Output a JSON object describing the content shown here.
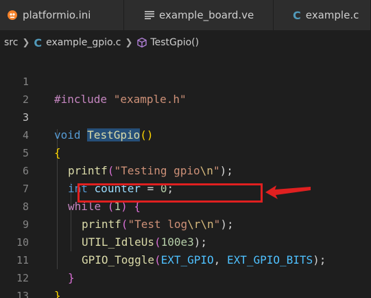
{
  "tabs": [
    {
      "label": "platformio.ini",
      "icon": "platformio-icon"
    },
    {
      "label": "example_board.ve",
      "icon": "lines-icon"
    },
    {
      "label": "example.c",
      "icon": "c-file-icon"
    }
  ],
  "breadcrumb": {
    "folder": "src",
    "file": "example_gpio.c",
    "symbol": "TestGpio()"
  },
  "editor": {
    "line_numbers": [
      "1",
      "2",
      "3",
      "4",
      "5",
      "6",
      "7",
      "8",
      "9",
      "10",
      "11",
      "12",
      "13"
    ],
    "active_line": "3",
    "code": {
      "l1_directive": "#include",
      "l1_header": "\"example.h\"",
      "l3_type": "void",
      "l3_func": "TestGpio",
      "l3_parens": "()",
      "l4_brace": "{",
      "l5_func": "printf",
      "l5_open": "(",
      "l5_str": "\"Testing gpio",
      "l5_esc": "\\n",
      "l5_str_end": "\"",
      "l5_close": ");",
      "l6_type": "int",
      "l6_var": "counter",
      "l6_eq": " = ",
      "l6_num": "0",
      "l6_semi": ";",
      "l7_kw": "while",
      "l7_open": " (",
      "l7_num": "1",
      "l7_close": ") ",
      "l7_brace": "{",
      "l8_func": "printf",
      "l8_open": "(",
      "l8_str": "\"Test log",
      "l8_esc": "\\r\\n",
      "l8_str_end": "\"",
      "l8_close": ");",
      "l9_func": "UTIL_IdleUs",
      "l9_open": "(",
      "l9_num": "100e3",
      "l9_close": ");",
      "l10_func": "GPIO_Toggle",
      "l10_open": "(",
      "l10_arg1": "EXT_GPIO",
      "l10_comma": ", ",
      "l10_arg2": "EXT_GPIO_BITS",
      "l10_close": ");",
      "l11_brace": "}",
      "l12_brace": "}"
    }
  },
  "colors": {
    "annotation": "#e02020",
    "background": "#1e1e1e"
  }
}
